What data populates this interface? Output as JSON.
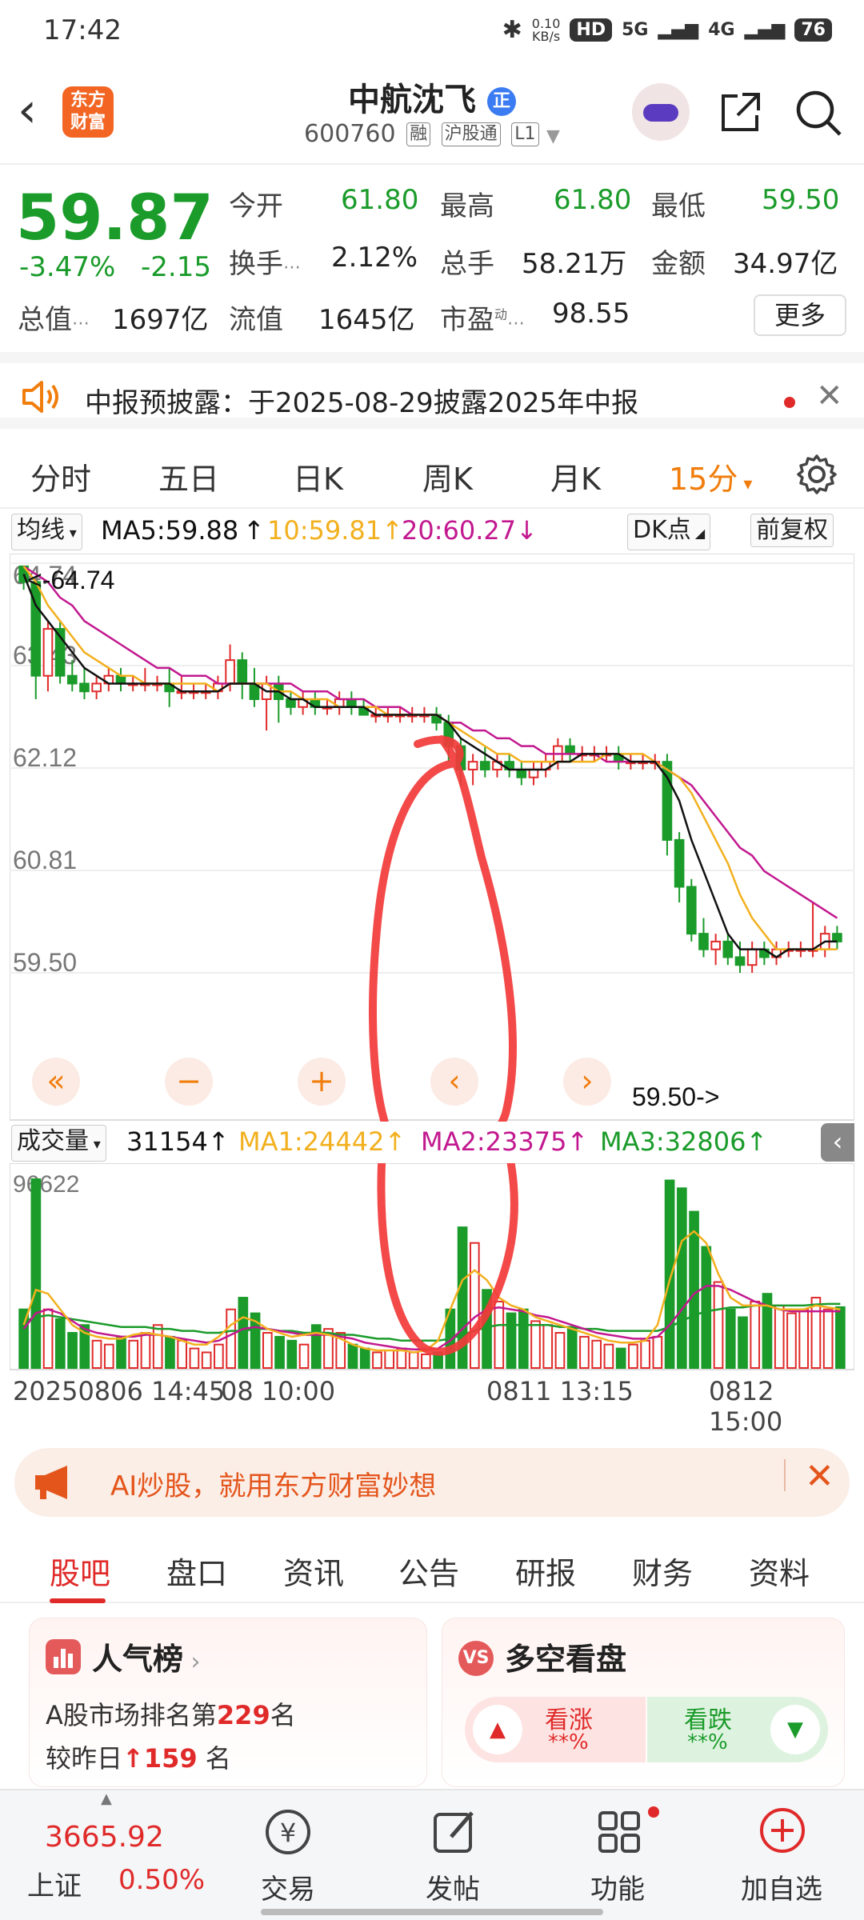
{
  "status_bar": {
    "time": "17:42",
    "net_speed": "0.10",
    "net_unit": "KB/s",
    "sim1": "5G",
    "sim2": "4G",
    "battery": "76",
    "hd": "HD"
  },
  "header": {
    "logo_line1": "东方",
    "logo_line2": "财富",
    "stock_name": "中航沈飞",
    "badge": "正",
    "code": "600760",
    "tag1": "融",
    "tag2": "沪股通",
    "tag3": "L1"
  },
  "quote": {
    "price": "59.87",
    "change_pct": "-3.47%",
    "change_amt": "-2.15",
    "fields": [
      {
        "label": "今开",
        "value": "61.80"
      },
      {
        "label": "最高",
        "value": "61.80"
      },
      {
        "label": "最低",
        "value": "59.50"
      },
      {
        "label": "换手",
        "value": "2.12%"
      },
      {
        "label": "总手",
        "value": "58.21万"
      },
      {
        "label": "金额",
        "value": "34.97亿"
      },
      {
        "label": "总值",
        "value": "1697亿"
      },
      {
        "label": "流值",
        "value": "1645亿"
      },
      {
        "label": "市盈",
        "value": "98.55"
      }
    ],
    "pe_sup": "动",
    "more_label": "更多"
  },
  "notice": {
    "text": "中报预披露：于2025-08-29披露2025年中报"
  },
  "chart_tabs": [
    "分时",
    "五日",
    "日K",
    "周K",
    "月K",
    "15分"
  ],
  "ma_row": {
    "ma_type": "均线",
    "ma5": "MA5:59.88",
    "ma10": "10:59.81",
    "ma20": "20:60.27",
    "dk": "DK点",
    "adjust": "前复权"
  },
  "chart_data": {
    "type": "candlestick",
    "y_ticks": [
      "64.74",
      "63.43",
      "62.12",
      "60.81",
      "59.50"
    ],
    "ylim": [
      59.5,
      64.74
    ],
    "high_marker": "64.74",
    "low_marker": "59.50",
    "x_ticks": [
      "20250806 14:45",
      "08 10:00",
      "0811 13:15",
      "0812 15:00"
    ],
    "candles": [
      [
        64.7,
        64.7,
        64.4,
        64.5
      ],
      [
        64.5,
        64.5,
        63.0,
        63.3
      ],
      [
        63.3,
        64.0,
        63.1,
        63.9
      ],
      [
        63.9,
        64.0,
        63.2,
        63.3
      ],
      [
        63.3,
        63.5,
        63.1,
        63.2
      ],
      [
        63.2,
        63.4,
        63.0,
        63.1
      ],
      [
        63.1,
        63.3,
        63.0,
        63.2
      ],
      [
        63.2,
        63.4,
        63.1,
        63.3
      ],
      [
        63.3,
        63.4,
        63.1,
        63.2
      ],
      [
        63.2,
        63.3,
        63.1,
        63.2
      ],
      [
        63.2,
        63.4,
        63.1,
        63.2
      ],
      [
        63.2,
        63.3,
        63.1,
        63.2
      ],
      [
        63.2,
        63.4,
        62.9,
        63.1
      ],
      [
        63.1,
        63.3,
        63.0,
        63.1
      ],
      [
        63.1,
        63.2,
        63.0,
        63.1
      ],
      [
        63.1,
        63.2,
        63.0,
        63.1
      ],
      [
        63.1,
        63.3,
        63.0,
        63.2
      ],
      [
        63.2,
        63.7,
        63.1,
        63.5
      ],
      [
        63.5,
        63.6,
        63.0,
        63.2
      ],
      [
        63.2,
        63.4,
        62.9,
        63.0
      ],
      [
        63.0,
        63.3,
        62.6,
        63.2
      ],
      [
        63.2,
        63.3,
        62.7,
        63.0
      ],
      [
        63.0,
        63.1,
        62.8,
        62.9
      ],
      [
        62.9,
        63.1,
        62.8,
        63.0
      ],
      [
        63.0,
        63.1,
        62.8,
        62.9
      ],
      [
        62.9,
        63.0,
        62.8,
        62.9
      ],
      [
        62.9,
        63.1,
        62.8,
        63.0
      ],
      [
        63.0,
        63.1,
        62.8,
        62.9
      ],
      [
        62.9,
        63.0,
        62.8,
        62.8
      ],
      [
        62.8,
        62.9,
        62.7,
        62.8
      ],
      [
        62.8,
        62.9,
        62.7,
        62.8
      ],
      [
        62.8,
        62.9,
        62.7,
        62.8
      ],
      [
        62.8,
        62.9,
        62.7,
        62.8
      ],
      [
        62.8,
        62.9,
        62.7,
        62.8
      ],
      [
        62.8,
        62.9,
        62.6,
        62.7
      ],
      [
        62.7,
        62.8,
        62.2,
        62.4
      ],
      [
        62.4,
        62.5,
        61.9,
        62.1
      ],
      [
        62.1,
        62.3,
        61.9,
        62.2
      ],
      [
        62.2,
        62.4,
        62.0,
        62.1
      ],
      [
        62.1,
        62.3,
        62.0,
        62.2
      ],
      [
        62.2,
        62.3,
        62.0,
        62.1
      ],
      [
        62.1,
        62.2,
        61.9,
        62.0
      ],
      [
        62.0,
        62.2,
        61.9,
        62.1
      ],
      [
        62.1,
        62.3,
        62.0,
        62.2
      ],
      [
        62.2,
        62.5,
        62.1,
        62.4
      ],
      [
        62.4,
        62.5,
        62.2,
        62.3
      ],
      [
        62.3,
        62.4,
        62.2,
        62.3
      ],
      [
        62.3,
        62.4,
        62.2,
        62.3
      ],
      [
        62.3,
        62.4,
        62.2,
        62.3
      ],
      [
        62.3,
        62.4,
        62.1,
        62.2
      ],
      [
        62.2,
        62.3,
        62.1,
        62.2
      ],
      [
        62.2,
        62.3,
        62.1,
        62.2
      ],
      [
        62.2,
        62.3,
        62.1,
        62.2
      ],
      [
        62.2,
        62.3,
        61.0,
        61.2
      ],
      [
        61.2,
        61.3,
        60.4,
        60.6
      ],
      [
        60.6,
        60.7,
        59.9,
        60.0
      ],
      [
        60.0,
        60.2,
        59.7,
        59.8
      ],
      [
        59.8,
        60.0,
        59.6,
        59.9
      ],
      [
        59.9,
        60.0,
        59.6,
        59.7
      ],
      [
        59.7,
        59.9,
        59.5,
        59.6
      ],
      [
        59.6,
        59.9,
        59.5,
        59.8
      ],
      [
        59.8,
        59.9,
        59.6,
        59.7
      ],
      [
        59.7,
        59.9,
        59.6,
        59.8
      ],
      [
        59.8,
        59.9,
        59.7,
        59.8
      ],
      [
        59.8,
        59.9,
        59.7,
        59.8
      ],
      [
        59.8,
        60.4,
        59.7,
        59.8
      ],
      [
        59.8,
        60.1,
        59.7,
        60.0
      ],
      [
        60.0,
        60.1,
        59.8,
        59.9
      ]
    ],
    "ma5": [
      64.6,
      64.2,
      64.0,
      63.8,
      63.6,
      63.4,
      63.3,
      63.2,
      63.2,
      63.2,
      63.2,
      63.2,
      63.2,
      63.1,
      63.1,
      63.1,
      63.1,
      63.2,
      63.2,
      63.2,
      63.1,
      63.1,
      63.0,
      63.0,
      62.9,
      62.9,
      62.9,
      62.9,
      62.9,
      62.8,
      62.8,
      62.8,
      62.8,
      62.8,
      62.8,
      62.7,
      62.5,
      62.4,
      62.3,
      62.2,
      62.1,
      62.1,
      62.1,
      62.1,
      62.2,
      62.2,
      62.3,
      62.3,
      62.3,
      62.3,
      62.2,
      62.2,
      62.2,
      62.0,
      61.7,
      61.2,
      60.8,
      60.4,
      60.0,
      59.8,
      59.8,
      59.8,
      59.7,
      59.8,
      59.8,
      59.8,
      59.9,
      59.9
    ],
    "ma10": [
      64.7,
      64.5,
      64.2,
      64.0,
      63.8,
      63.6,
      63.5,
      63.4,
      63.3,
      63.3,
      63.2,
      63.2,
      63.2,
      63.2,
      63.2,
      63.2,
      63.1,
      63.2,
      63.2,
      63.2,
      63.2,
      63.1,
      63.1,
      63.0,
      63.0,
      63.0,
      62.9,
      62.9,
      62.9,
      62.9,
      62.8,
      62.8,
      62.8,
      62.8,
      62.8,
      62.7,
      62.6,
      62.5,
      62.4,
      62.3,
      62.3,
      62.2,
      62.2,
      62.2,
      62.2,
      62.2,
      62.2,
      62.2,
      62.3,
      62.3,
      62.3,
      62.3,
      62.2,
      62.1,
      62.0,
      61.8,
      61.5,
      61.2,
      60.9,
      60.5,
      60.2,
      60.0,
      59.8,
      59.8,
      59.8,
      59.8,
      59.8,
      59.8
    ],
    "ma20": [
      64.7,
      64.6,
      64.5,
      64.3,
      64.2,
      64.0,
      63.9,
      63.8,
      63.7,
      63.6,
      63.5,
      63.4,
      63.4,
      63.3,
      63.3,
      63.3,
      63.2,
      63.2,
      63.2,
      63.2,
      63.2,
      63.2,
      63.2,
      63.1,
      63.1,
      63.1,
      63.0,
      63.0,
      63.0,
      62.9,
      62.9,
      62.9,
      62.8,
      62.8,
      62.8,
      62.7,
      62.7,
      62.6,
      62.6,
      62.5,
      62.5,
      62.4,
      62.4,
      62.3,
      62.3,
      62.3,
      62.3,
      62.3,
      62.2,
      62.2,
      62.2,
      62.2,
      62.2,
      62.1,
      62.0,
      61.9,
      61.7,
      61.5,
      61.3,
      61.1,
      61.0,
      60.8,
      60.7,
      60.6,
      60.5,
      60.4,
      60.3,
      60.2
    ],
    "volume": {
      "header": "成交量",
      "current": "31154",
      "ma1": "MA1:24442",
      "ma2": "MA2:23375",
      "ma3": "MA3:32806",
      "max_label": "96622",
      "ymax": 96622,
      "values": [
        30000,
        96622,
        30000,
        25000,
        18000,
        22000,
        14000,
        12000,
        16000,
        14000,
        18000,
        22000,
        16000,
        14000,
        10000,
        8000,
        12000,
        30000,
        36000,
        28000,
        18000,
        16000,
        14000,
        12000,
        22000,
        20000,
        18000,
        12000,
        10000,
        8000,
        9000,
        10000,
        8000,
        7000,
        8000,
        30000,
        72000,
        64000,
        40000,
        34000,
        28000,
        30000,
        24000,
        22000,
        18000,
        20000,
        16000,
        14000,
        12000,
        10000,
        12000,
        14000,
        16000,
        96000,
        92000,
        80000,
        62000,
        44000,
        30000,
        26000,
        34000,
        38000,
        32000,
        28000,
        30000,
        36000,
        30000,
        31154
      ],
      "ma1_line": [
        22000,
        40000,
        38000,
        30000,
        22000,
        18000,
        16000,
        15000,
        15000,
        17000,
        18000,
        17000,
        16000,
        14000,
        12000,
        12000,
        16000,
        22000,
        26000,
        24000,
        20000,
        18000,
        16000,
        17000,
        18000,
        17000,
        15000,
        12000,
        10000,
        9000,
        9000,
        9000,
        8000,
        9000,
        14000,
        30000,
        45000,
        50000,
        45000,
        36000,
        32000,
        30000,
        26000,
        24000,
        22000,
        20000,
        18000,
        16000,
        14000,
        13000,
        13000,
        14000,
        22000,
        45000,
        65000,
        70000,
        64000,
        48000,
        36000,
        32000,
        32000,
        32000,
        30000,
        30000,
        30000,
        32000,
        31000,
        30000
      ],
      "ma2_line": [
        20000,
        28000,
        30000,
        28000,
        24000,
        20000,
        18000,
        17000,
        16000,
        16000,
        17000,
        17000,
        16000,
        15000,
        14000,
        13000,
        14000,
        17000,
        20000,
        21000,
        20000,
        19000,
        18000,
        17000,
        17000,
        17000,
        16000,
        15000,
        13000,
        12000,
        11000,
        10000,
        9500,
        9500,
        10000,
        14000,
        20000,
        26000,
        30000,
        31000,
        30000,
        29000,
        27000,
        26000,
        24000,
        22000,
        20000,
        18000,
        17000,
        16000,
        15000,
        15000,
        16000,
        22000,
        30000,
        38000,
        42000,
        42000,
        40000,
        37000,
        34000,
        32000,
        30000,
        29000,
        29000,
        29000,
        29000,
        29000
      ],
      "ma3_line": [
        24000,
        26000,
        27000,
        26000,
        25000,
        24000,
        23000,
        22000,
        21000,
        21000,
        21000,
        20000,
        20000,
        19000,
        19000,
        18000,
        18000,
        19000,
        19000,
        20000,
        20000,
        19000,
        19000,
        18000,
        18000,
        18000,
        17000,
        17000,
        16000,
        15000,
        15000,
        14000,
        14000,
        14000,
        14000,
        15000,
        17000,
        19000,
        21000,
        22000,
        22000,
        22000,
        22000,
        22000,
        21000,
        21000,
        20000,
        20000,
        19000,
        19000,
        19000,
        19000,
        19000,
        21000,
        24000,
        27000,
        29000,
        30000,
        31000,
        31000,
        32000,
        32000,
        32000,
        32000,
        32000,
        32500,
        32800,
        32806
      ]
    }
  },
  "ai_banner": {
    "text": "AI炒股，就用东方财富妙想"
  },
  "section_tabs": [
    "股吧",
    "盘口",
    "资讯",
    "公告",
    "研报",
    "财务",
    "资料"
  ],
  "popularity": {
    "title": "人气榜",
    "line1_prefix": "A股市场排名第",
    "rank": "229",
    "line1_suffix": "名",
    "line2_prefix": "较昨日",
    "rank_change": "159",
    "line2_suffix": "名"
  },
  "bull_bear": {
    "title": "多空看盘",
    "bull_label": "看涨",
    "bull_pct": "**%",
    "bear_label": "看跌",
    "bear_pct": "**%"
  },
  "bottom_nav": {
    "index_value": "3665.92",
    "index_name": "上证",
    "index_change": "0.50%",
    "items": [
      "交易",
      "发帖",
      "功能",
      "加自选"
    ]
  },
  "colors": {
    "up": "#e02a2a",
    "down": "#1a9b2a",
    "accent": "#f07d0c",
    "ma5": "#111111",
    "ma10": "#f2b01e",
    "ma20": "#c2188f"
  }
}
